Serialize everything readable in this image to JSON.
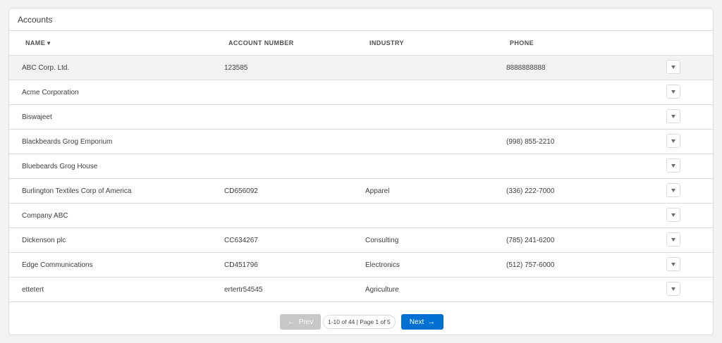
{
  "card": {
    "title": "Accounts"
  },
  "table": {
    "columns": {
      "name": "NAME",
      "name_sort": "▼",
      "account_number": "ACCOUNT NUMBER",
      "industry": "INDUSTRY",
      "phone": "PHONE"
    },
    "rows": [
      {
        "name": "ABC Corp. Ltd.",
        "account_number": "123585",
        "industry": "",
        "phone": "8888888888"
      },
      {
        "name": "Acme Corporation",
        "account_number": "",
        "industry": "",
        "phone": ""
      },
      {
        "name": "Biswajeet",
        "account_number": "",
        "industry": "",
        "phone": ""
      },
      {
        "name": "Blackbeards Grog Emporium",
        "account_number": "",
        "industry": "",
        "phone": "(998) 855-2210"
      },
      {
        "name": "Bluebeards Grog House",
        "account_number": "",
        "industry": "",
        "phone": ""
      },
      {
        "name": "Burlington Textiles Corp of America",
        "account_number": "CD656092",
        "industry": "Apparel",
        "phone": "(336) 222-7000"
      },
      {
        "name": "Company ABC",
        "account_number": "",
        "industry": "",
        "phone": ""
      },
      {
        "name": "Dickenson plc",
        "account_number": "CC634267",
        "industry": "Consulting",
        "phone": "(785) 241-6200"
      },
      {
        "name": "Edge Communications",
        "account_number": "CD451796",
        "industry": "Electronics",
        "phone": "(512) 757-6000"
      },
      {
        "name": "ettetert",
        "account_number": "ertertr54545",
        "industry": "Agriculture",
        "phone": ""
      }
    ],
    "row_action_icon": "chevron-down-icon"
  },
  "pagination": {
    "prev_label": "Prev",
    "prev_icon": "←",
    "page_info": "1-10 of 44 | Page 1 of 5",
    "next_label": "Next",
    "next_icon": "→"
  },
  "colors": {
    "brand": "#0070d2",
    "disabled": "#c9c7c5",
    "border": "#dddbda",
    "row_highlight": "#f3f2f2"
  }
}
